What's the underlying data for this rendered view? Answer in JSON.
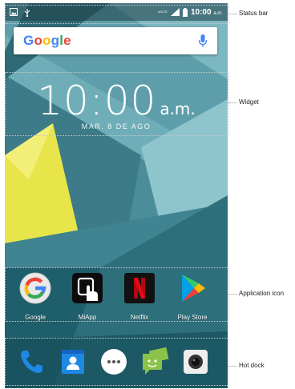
{
  "status_bar": {
    "network": "4GLTE",
    "time": "10:00",
    "ampm": "a.m."
  },
  "search": {
    "logo_letters": [
      {
        "char": "G",
        "color": "#4285F4"
      },
      {
        "char": "o",
        "color": "#EA4335"
      },
      {
        "char": "o",
        "color": "#FBBC05"
      },
      {
        "char": "g",
        "color": "#4285F4"
      },
      {
        "char": "l",
        "color": "#34A853"
      },
      {
        "char": "e",
        "color": "#EA4335"
      }
    ],
    "mic_icon": "microphone-icon"
  },
  "widget": {
    "time": "10:00",
    "ampm": "a.m.",
    "date": "MAR. 8 DE AGO"
  },
  "apps": [
    {
      "label": "Google",
      "icon": "google-icon"
    },
    {
      "label": "MiApp",
      "icon": "miapp-icon"
    },
    {
      "label": "Netflix",
      "icon": "netflix-icon"
    },
    {
      "label": "Play Store",
      "icon": "play-store-icon"
    }
  ],
  "dock": [
    {
      "icon": "phone-icon"
    },
    {
      "icon": "contacts-icon"
    },
    {
      "icon": "app-drawer-icon"
    },
    {
      "icon": "messaging-icon"
    },
    {
      "icon": "camera-icon"
    }
  ],
  "callouts": {
    "status_bar": "Status bar",
    "widget": "Widget",
    "apps": "Application icon",
    "dock": "Hot dock"
  },
  "colors": {
    "wallpaper_base": "#3f7f8c",
    "accent_yellow": "#e8e54a",
    "netflix_red": "#e50914"
  }
}
